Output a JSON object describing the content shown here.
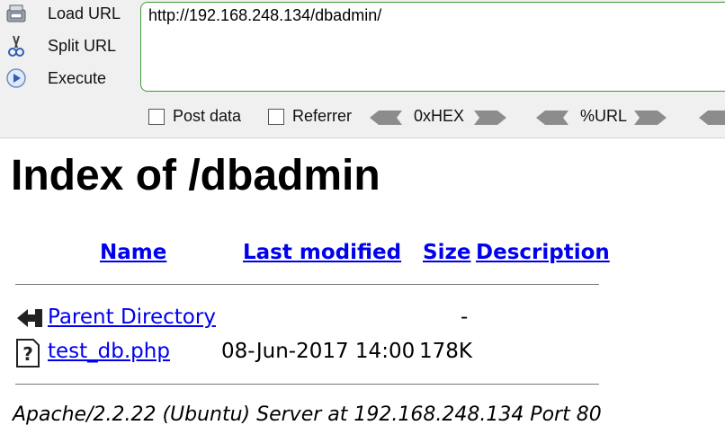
{
  "hackbar": {
    "actions": {
      "load": "Load URL",
      "split": "Split URL",
      "execute": "Execute"
    },
    "url": "http://192.168.248.134/dbadmin/",
    "options": {
      "post_data": "Post data",
      "referrer": "Referrer",
      "hex": "0xHEX",
      "url_encode": "%URL"
    }
  },
  "page": {
    "title": "Index of /dbadmin",
    "columns": {
      "name": "Name",
      "last_modified": "Last modified",
      "size": "Size",
      "description": "Description"
    },
    "rows": [
      {
        "icon": "back-arrow-icon",
        "name": "Parent Directory",
        "last_modified": "",
        "size": "-",
        "description": ""
      },
      {
        "icon": "unknown-file-icon",
        "name": "test_db.php",
        "last_modified": "08-Jun-2017 14:00",
        "size": "178K",
        "description": ""
      }
    ],
    "footer": "Apache/2.2.22 (Ubuntu) Server at 192.168.248.134 Port 80"
  },
  "colors": {
    "link": "#0000ee",
    "url_border": "#3c9a3c",
    "toolbar_bg": "#f0f0f0"
  }
}
